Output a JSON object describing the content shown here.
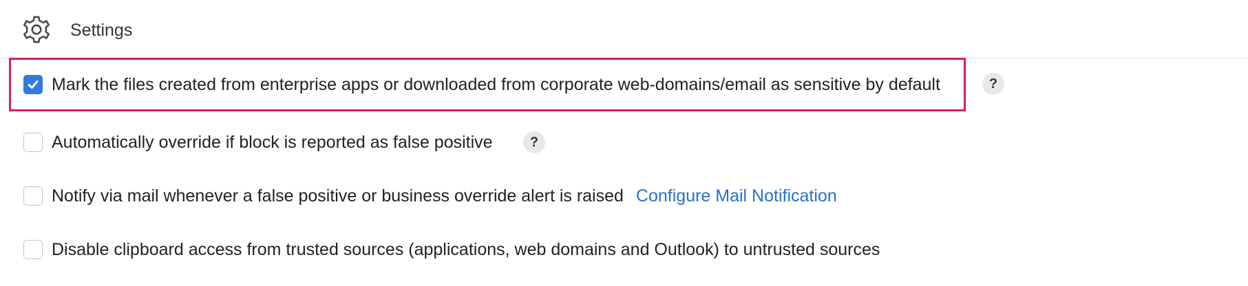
{
  "header": {
    "title": "Settings",
    "icon": "gear-icon"
  },
  "settings": {
    "items": [
      {
        "label": "Mark the files created from enterprise apps or downloaded from corporate web-domains/email as sensitive by default",
        "checked": true,
        "help": "?"
      },
      {
        "label": "Automatically override if block is reported as false positive",
        "checked": false,
        "help": "?"
      },
      {
        "label": "Notify via mail whenever a false positive or business override alert is raised",
        "checked": false,
        "link": "Configure Mail Notification"
      },
      {
        "label": "Disable clipboard access from trusted sources (applications, web domains and Outlook) to untrusted sources",
        "checked": false
      }
    ]
  },
  "colors": {
    "accent": "#2f7bde",
    "highlight_border": "#e3195a",
    "link": "#2a6fd1"
  }
}
